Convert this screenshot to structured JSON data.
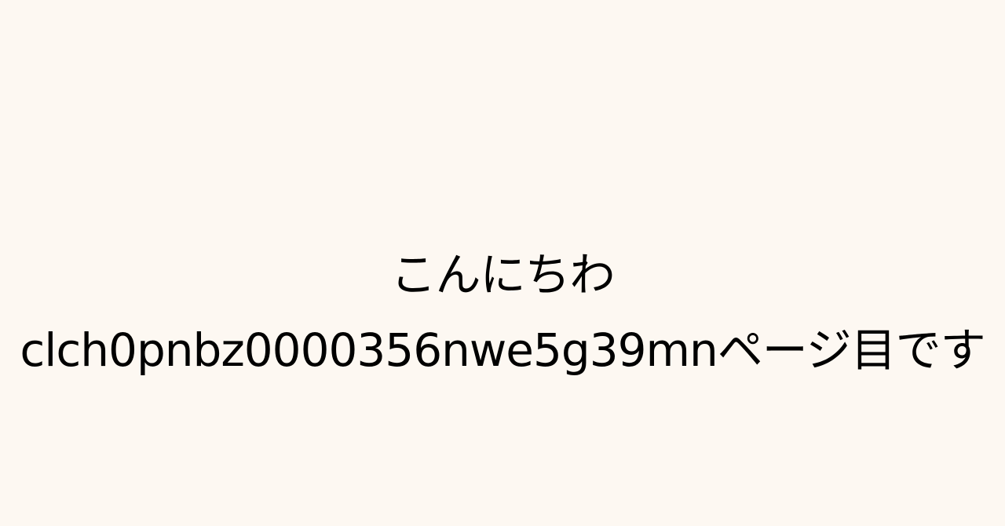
{
  "content": {
    "greeting": "こんにちわ",
    "page_line": "clch0pnbz0000356nwe5g39mnページ目です"
  },
  "colors": {
    "background": "#fdf8f2",
    "text": "#000000"
  }
}
